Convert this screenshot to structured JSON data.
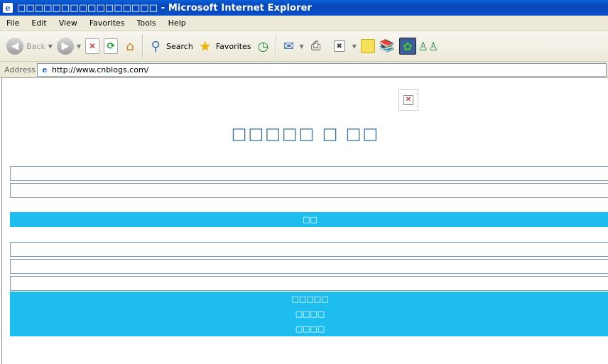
{
  "window": {
    "title": "□□□□□□□□□□□□□□□□ - Microsoft Internet Explorer"
  },
  "menu": [
    "File",
    "Edit",
    "View",
    "Favorites",
    "Tools",
    "Help"
  ],
  "toolbar": {
    "back": "Back",
    "search": "Search",
    "favorites": "Favorites"
  },
  "address": {
    "label": "Address",
    "url": "http://www.cnblogs.com/"
  },
  "page": {
    "heading": "□□□□□ □ □□",
    "band1": "□□",
    "band2": [
      "□□□□□",
      "□□□□",
      "□□□□"
    ]
  },
  "colors": {
    "band": "#1ebdf0",
    "heading": "#2e6fa8",
    "titlebar": "#0a50c9"
  }
}
